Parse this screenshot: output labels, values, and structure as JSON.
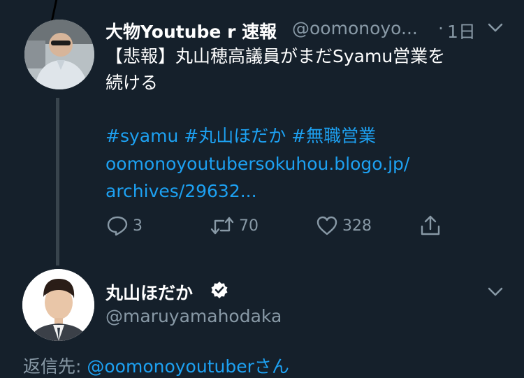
{
  "tweet": {
    "display_name": "大物Youtube r 速報",
    "handle": "@oomonoyo...",
    "separator": "·",
    "time": "1日",
    "text_line1": "【悲報】丸山穂高議員がまだSyamu営業を",
    "text_line2": "続ける",
    "hashtags": [
      "#syamu",
      "#丸山ほだか",
      "#無職営業"
    ],
    "url_line1": "oomonoyoutubersokuhou.blogo.jp/",
    "url_line2": "archives/29632...",
    "reply_count": "3",
    "retweet_count": "70",
    "like_count": "328"
  },
  "reply": {
    "display_name": "丸山ほだか",
    "handle": "@maruyamahodaka",
    "replying_to_prefix": "返信先: ",
    "replying_to_handle": "@oomonoyoutuber",
    "replying_to_suffix": "さん"
  },
  "colors": {
    "background": "#15202b",
    "accent": "#1da1f2",
    "muted": "#8899a6",
    "thread_line": "#38444d"
  }
}
